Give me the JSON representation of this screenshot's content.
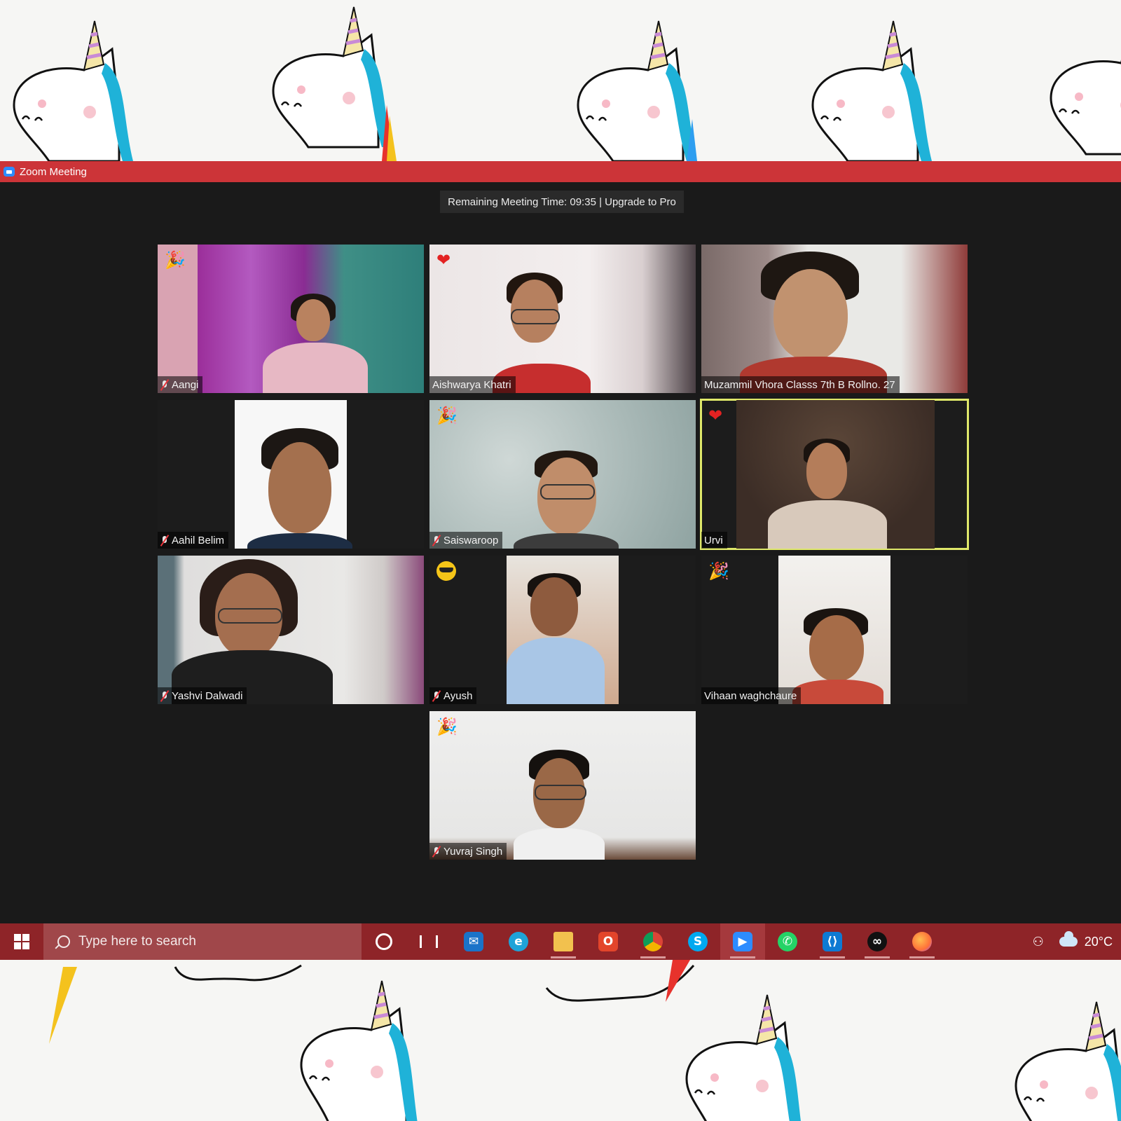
{
  "window": {
    "title": "Zoom Meeting"
  },
  "banner": {
    "remaining_text": "Remaining Meeting Time: 09:35 | Upgrade to Pro"
  },
  "participants": [
    {
      "name": "Aangi",
      "muted": true,
      "reaction": "party-popper",
      "active": false
    },
    {
      "name": "Aishwarya Khatri",
      "muted": false,
      "reaction": "heart",
      "active": false
    },
    {
      "name": "Muzammil Vhora Classs 7th B Rollno. 27",
      "muted": false,
      "reaction": "",
      "active": false
    },
    {
      "name": "Aahil Belim",
      "muted": true,
      "reaction": "",
      "active": false
    },
    {
      "name": "Saiswaroop",
      "muted": true,
      "reaction": "party-popper",
      "active": false
    },
    {
      "name": "Urvi",
      "muted": false,
      "reaction": "heart",
      "active": true
    },
    {
      "name": "Yashvi Dalwadi",
      "muted": true,
      "reaction": "",
      "active": false
    },
    {
      "name": "Ayush",
      "muted": true,
      "reaction": "sunglasses-face",
      "active": false
    },
    {
      "name": "Vihaan waghchaure",
      "muted": false,
      "reaction": "party-popper",
      "active": false
    },
    {
      "name": "Yuvraj Singh",
      "muted": true,
      "reaction": "party-popper",
      "active": false
    }
  ],
  "taskbar": {
    "search_placeholder": "Type here to search",
    "apps": [
      "cortana",
      "task-view",
      "mail",
      "edge",
      "file-explorer",
      "office",
      "chrome",
      "skype",
      "zoom",
      "whatsapp",
      "vscode",
      "webex",
      "firefox"
    ],
    "temperature": "20°C"
  },
  "colors": {
    "titlebar": "#cc3438",
    "taskbar": "#8e2428",
    "meeting_bg": "#1a1a1a",
    "active_speaker": "#dfe86a"
  }
}
